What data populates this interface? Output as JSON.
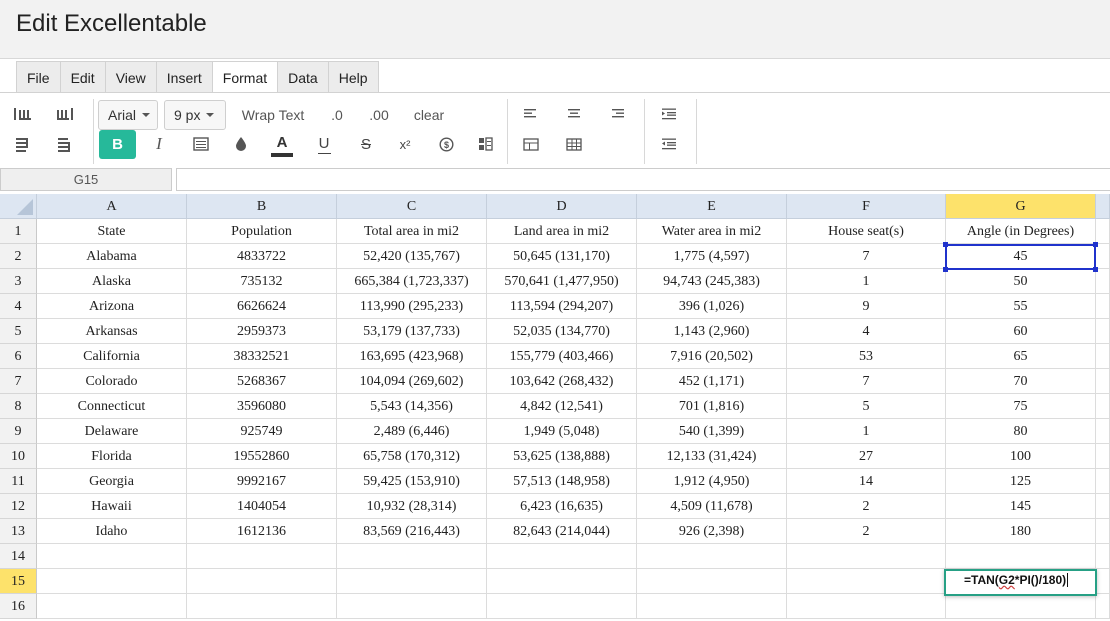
{
  "app": {
    "title": "Edit Excellentable"
  },
  "menu": [
    "File",
    "Edit",
    "View",
    "Insert",
    "Format",
    "Data",
    "Help"
  ],
  "menu_active": "Format",
  "toolbar": {
    "font_family": "Arial",
    "font_size": "9 px",
    "wrap_text": "Wrap Text",
    "decimal_decrease": ".0",
    "decimal_increase": ".00",
    "clear": "clear",
    "bold": "B",
    "italic": "I",
    "font_color_glyph": "A",
    "underline_glyph": "U",
    "strike_glyph": "S",
    "superscript_glyph": "x²",
    "accent_color": "#26b99a"
  },
  "formula_bar": {
    "cell_ref": "G15",
    "value": ""
  },
  "grid": {
    "columns": [
      "A",
      "B",
      "C",
      "D",
      "E",
      "F",
      "G"
    ],
    "selected_column": "G",
    "row_numbers": [
      "1",
      "2",
      "3",
      "4",
      "5",
      "6",
      "7",
      "8",
      "9",
      "10",
      "11",
      "12",
      "13",
      "14",
      "15",
      "16"
    ],
    "selected_row": "15",
    "rows": [
      [
        "State",
        "Population",
        "Total area in mi2",
        "Land area in mi2",
        "Water area in mi2",
        "House seat(s)",
        "Angle (in Degrees)"
      ],
      [
        "Alabama",
        "4833722",
        "52,420 (135,767)",
        "50,645 (131,170)",
        "1,775 (4,597)",
        "7",
        "45"
      ],
      [
        "Alaska",
        "735132",
        "665,384 (1,723,337)",
        "570,641 (1,477,950)",
        "94,743 (245,383)",
        "1",
        "50"
      ],
      [
        "Arizona",
        "6626624",
        "113,990 (295,233)",
        "113,594 (294,207)",
        "396 (1,026)",
        "9",
        "55"
      ],
      [
        "Arkansas",
        "2959373",
        "53,179 (137,733)",
        "52,035 (134,770)",
        "1,143 (2,960)",
        "4",
        "60"
      ],
      [
        "California",
        "38332521",
        "163,695 (423,968)",
        "155,779 (403,466)",
        "7,916 (20,502)",
        "53",
        "65"
      ],
      [
        "Colorado",
        "5268367",
        "104,094 (269,602)",
        "103,642 (268,432)",
        "452 (1,171)",
        "7",
        "70"
      ],
      [
        "Connecticut",
        "3596080",
        "5,543 (14,356)",
        "4,842 (12,541)",
        "701 (1,816)",
        "5",
        "75"
      ],
      [
        "Delaware",
        "925749",
        "2,489 (6,446)",
        "1,949 (5,048)",
        "540 (1,399)",
        "1",
        "80"
      ],
      [
        "Florida",
        "19552860",
        "65,758 (170,312)",
        "53,625 (138,888)",
        "12,133 (31,424)",
        "27",
        "100"
      ],
      [
        "Georgia",
        "9992167",
        "59,425 (153,910)",
        "57,513 (148,958)",
        "1,912 (4,950)",
        "14",
        "125"
      ],
      [
        "Hawaii",
        "1404054",
        "10,932 (28,314)",
        "6,423 (16,635)",
        "4,509 (11,678)",
        "2",
        "145"
      ],
      [
        "Idaho",
        "1612136",
        "83,569 (216,443)",
        "82,643 (214,044)",
        "926 (2,398)",
        "2",
        "180"
      ],
      [
        "",
        "",
        "",
        "",
        "",
        "",
        ""
      ],
      [
        "",
        "",
        "",
        "",
        "",
        "",
        ""
      ],
      [
        "",
        "",
        "",
        "",
        "",
        "",
        ""
      ]
    ],
    "selected_cell": "G2",
    "editing": {
      "cell": "G15",
      "formula_prefix": "=TAN(",
      "formula_ref": "G2",
      "formula_suffix": "*PI()/180)"
    }
  }
}
